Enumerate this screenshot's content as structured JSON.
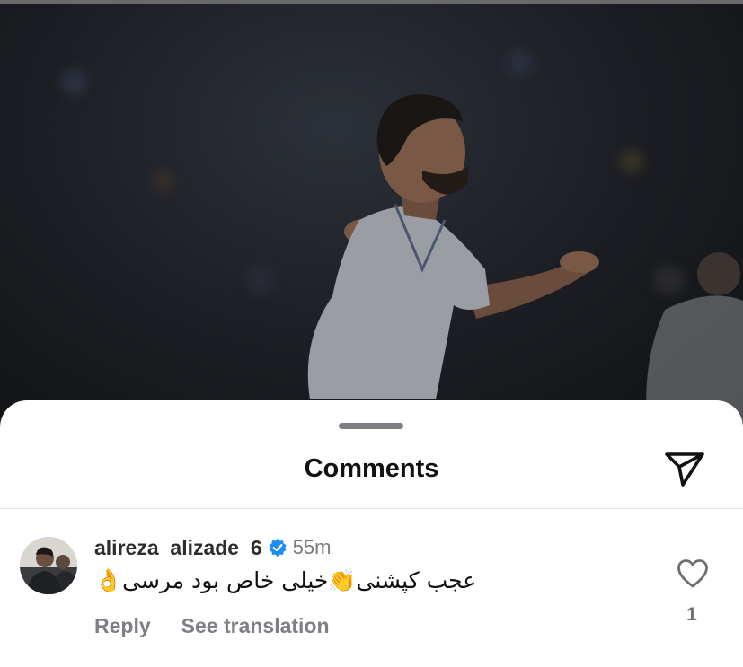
{
  "sheet": {
    "title": "Comments",
    "share_icon": "paper-plane-icon"
  },
  "comment": {
    "username": "alireza_alizade_6",
    "verified_icon": "verified-badge-icon",
    "time": "55m",
    "text": "👌عجب کپشنی👏خیلی خاص بود مرسی",
    "reply_label": "Reply",
    "translate_label": "See translation",
    "like_icon": "heart-outline-icon",
    "like_count": "1"
  },
  "colors": {
    "sheet_bg": "#ffffff",
    "secondary_text": "#7d7f84",
    "verified_blue": "#1f8ef1"
  }
}
